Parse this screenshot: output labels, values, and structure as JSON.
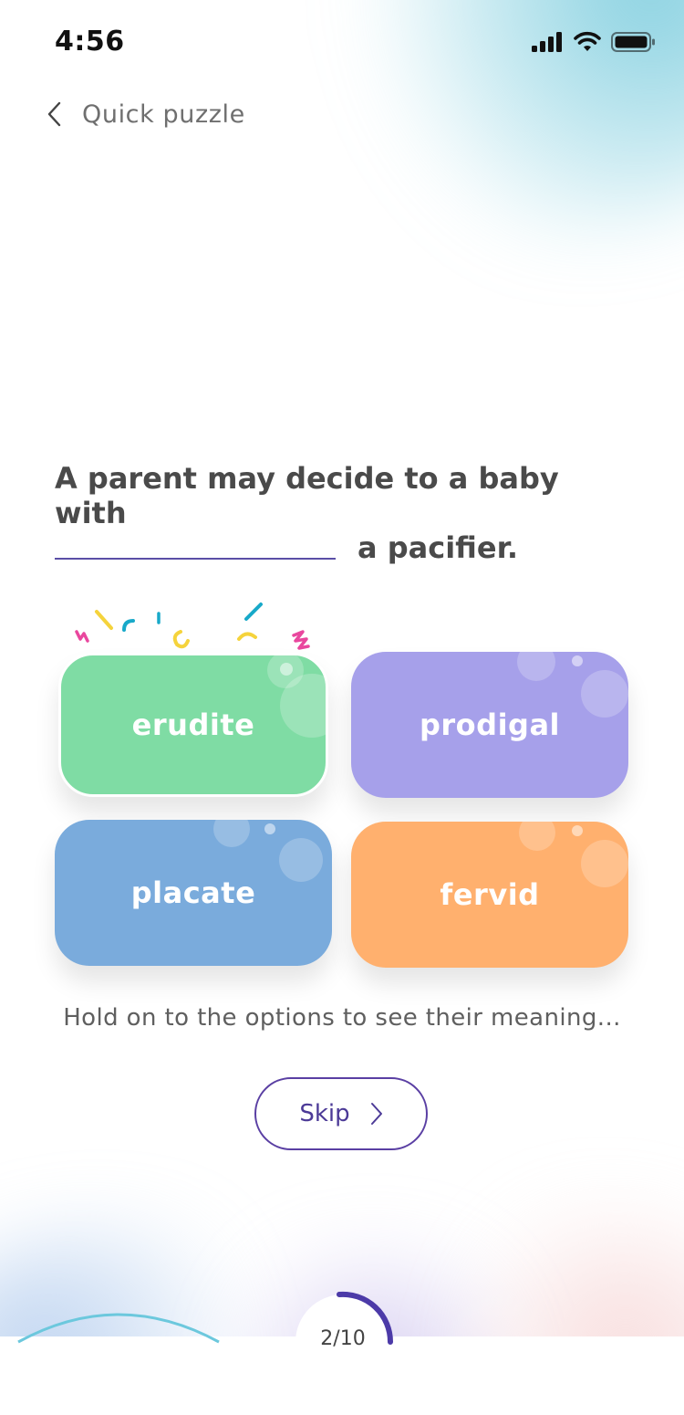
{
  "status_bar": {
    "time": "4:56"
  },
  "nav": {
    "back_icon": "chevron-left-icon",
    "title": "Quick puzzle"
  },
  "question": {
    "line1": "A parent may decide to a baby with",
    "line2_tail": "a pacifier."
  },
  "options": [
    {
      "label": "erudite",
      "color": "#7fdca4",
      "selected": true
    },
    {
      "label": "prodigal",
      "color": "#a6a0ea",
      "selected": false
    },
    {
      "label": "placate",
      "color": "#7aabdc",
      "selected": false
    },
    {
      "label": "fervid",
      "color": "#ffb06e",
      "selected": false
    }
  ],
  "hint": "Hold on to the options to see their meaning...",
  "skip": {
    "label": "Skip",
    "icon": "chevron-right-icon"
  },
  "progress": {
    "text": "2/10"
  },
  "colors": {
    "accent": "#5a3fa3",
    "question_text": "#4a4a4a",
    "confetti_pink": "#e9479e",
    "confetti_yellow": "#f5d33c",
    "confetti_teal": "#18a9c9"
  }
}
